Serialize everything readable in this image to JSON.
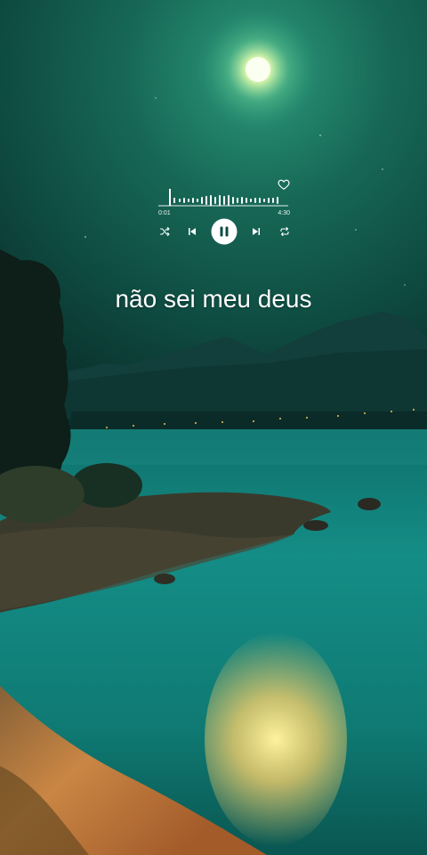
{
  "player": {
    "elapsed": "0:01",
    "duration": "4:30",
    "progress": 0.03,
    "is_playing": true,
    "liked": false
  },
  "lyric": {
    "text": "não sei meu deus"
  },
  "icons": {
    "heart": "heart-icon",
    "shuffle": "shuffle-icon",
    "previous": "skip-previous-icon",
    "pause": "pause-icon",
    "next": "skip-next-icon",
    "repeat": "repeat-icon"
  },
  "colors": {
    "sky_top": "#0a2c2a",
    "sky_glow": "#1f7a64",
    "water": "#1aa39a",
    "moon": "#f8ffd8",
    "sand": "#c97a3d"
  }
}
